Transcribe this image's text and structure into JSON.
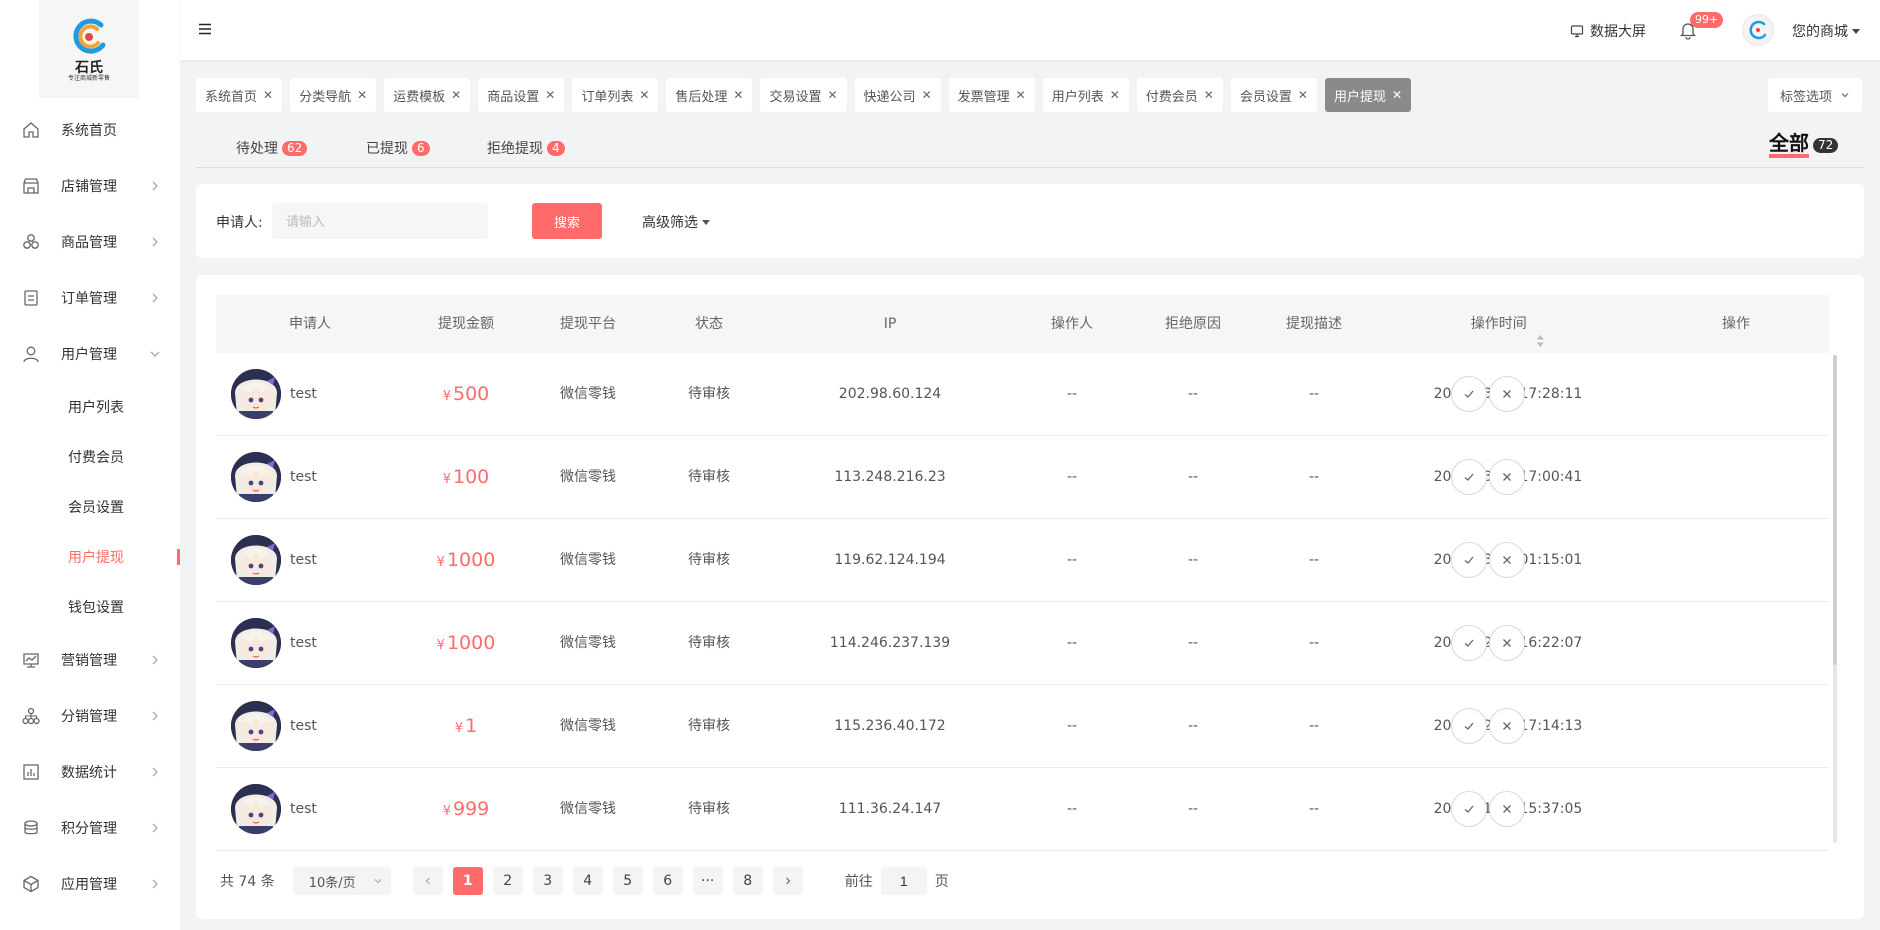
{
  "brand": {
    "name": "石氏",
    "tagline": "专注商城新零售"
  },
  "sidebar": {
    "items": [
      {
        "label": "系统首页",
        "icon": "home-icon"
      },
      {
        "label": "店铺管理",
        "icon": "store-icon"
      },
      {
        "label": "商品管理",
        "icon": "goods-icon"
      },
      {
        "label": "订单管理",
        "icon": "order-icon"
      },
      {
        "label": "用户管理",
        "icon": "user-icon"
      },
      {
        "label": "营销管理",
        "icon": "marketing-icon"
      },
      {
        "label": "分销管理",
        "icon": "distribution-icon"
      },
      {
        "label": "数据统计",
        "icon": "stats-icon"
      },
      {
        "label": "积分管理",
        "icon": "points-icon"
      },
      {
        "label": "应用管理",
        "icon": "apps-icon"
      }
    ],
    "user_sub": [
      "用户列表",
      "付费会员",
      "会员设置",
      "用户提现",
      "钱包设置"
    ],
    "active_sub": "用户提现"
  },
  "header": {
    "data_screen": "数据大屏",
    "notif_badge": "99+",
    "store_name": "您的商城"
  },
  "tags": [
    "系统首页",
    "分类导航",
    "运费模板",
    "商品设置",
    "订单列表",
    "售后处理",
    "交易设置",
    "快递公司",
    "发票管理",
    "用户列表",
    "付费会员",
    "会员设置",
    "用户提现"
  ],
  "active_tag": "用户提现",
  "tag_options": "标签选项",
  "status_tabs": {
    "pending": {
      "label": "待处理",
      "count": "62"
    },
    "withdrawn": {
      "label": "已提现",
      "count": "6"
    },
    "rejected": {
      "label": "拒绝提现",
      "count": "4"
    },
    "all": {
      "label": "全部",
      "count": "72"
    }
  },
  "search": {
    "label": "申请人:",
    "placeholder": "请输入",
    "button": "搜索",
    "advanced": "高级筛选"
  },
  "table": {
    "columns": [
      "申请人",
      "提现金额",
      "提现平台",
      "状态",
      "IP",
      "操作人",
      "拒绝原因",
      "提现描述",
      "操作时间",
      "操作"
    ],
    "currency": "¥",
    "rows": [
      {
        "name": "test",
        "amount": "500",
        "platform": "微信零钱",
        "status": "待审核",
        "ip": "202.98.60.124",
        "operator": "--",
        "reason": "--",
        "desc": "--",
        "time": "2025-03-13 17:28:11"
      },
      {
        "name": "test",
        "amount": "100",
        "platform": "微信零钱",
        "status": "待审核",
        "ip": "113.248.216.23",
        "operator": "--",
        "reason": "--",
        "desc": "--",
        "time": "2025-03-03 17:00:41"
      },
      {
        "name": "test",
        "amount": "1000",
        "platform": "微信零钱",
        "status": "待审核",
        "ip": "119.62.124.194",
        "operator": "--",
        "reason": "--",
        "desc": "--",
        "time": "2025-03-02 01:15:01"
      },
      {
        "name": "test",
        "amount": "1000",
        "platform": "微信零钱",
        "status": "待审核",
        "ip": "114.246.237.139",
        "operator": "--",
        "reason": "--",
        "desc": "--",
        "time": "2025-02-19 16:22:07"
      },
      {
        "name": "test",
        "amount": "1",
        "platform": "微信零钱",
        "status": "待审核",
        "ip": "115.236.40.172",
        "operator": "--",
        "reason": "--",
        "desc": "--",
        "time": "2025-02-17 17:14:13"
      },
      {
        "name": "test",
        "amount": "999",
        "platform": "微信零钱",
        "status": "待审核",
        "ip": "111.36.24.147",
        "operator": "--",
        "reason": "--",
        "desc": "--",
        "time": "2025-01-23 15:37:05"
      }
    ]
  },
  "pagination": {
    "total": "共 74 条",
    "page_size": "10条/页",
    "pages": [
      "1",
      "2",
      "3",
      "4",
      "5",
      "6",
      "···",
      "8"
    ],
    "current": "1",
    "goto_prefix": "前往",
    "goto_value": "1",
    "goto_suffix": "页"
  },
  "colors": {
    "accent": "#ff6b6b",
    "active_tag": "#8a8a8a"
  }
}
